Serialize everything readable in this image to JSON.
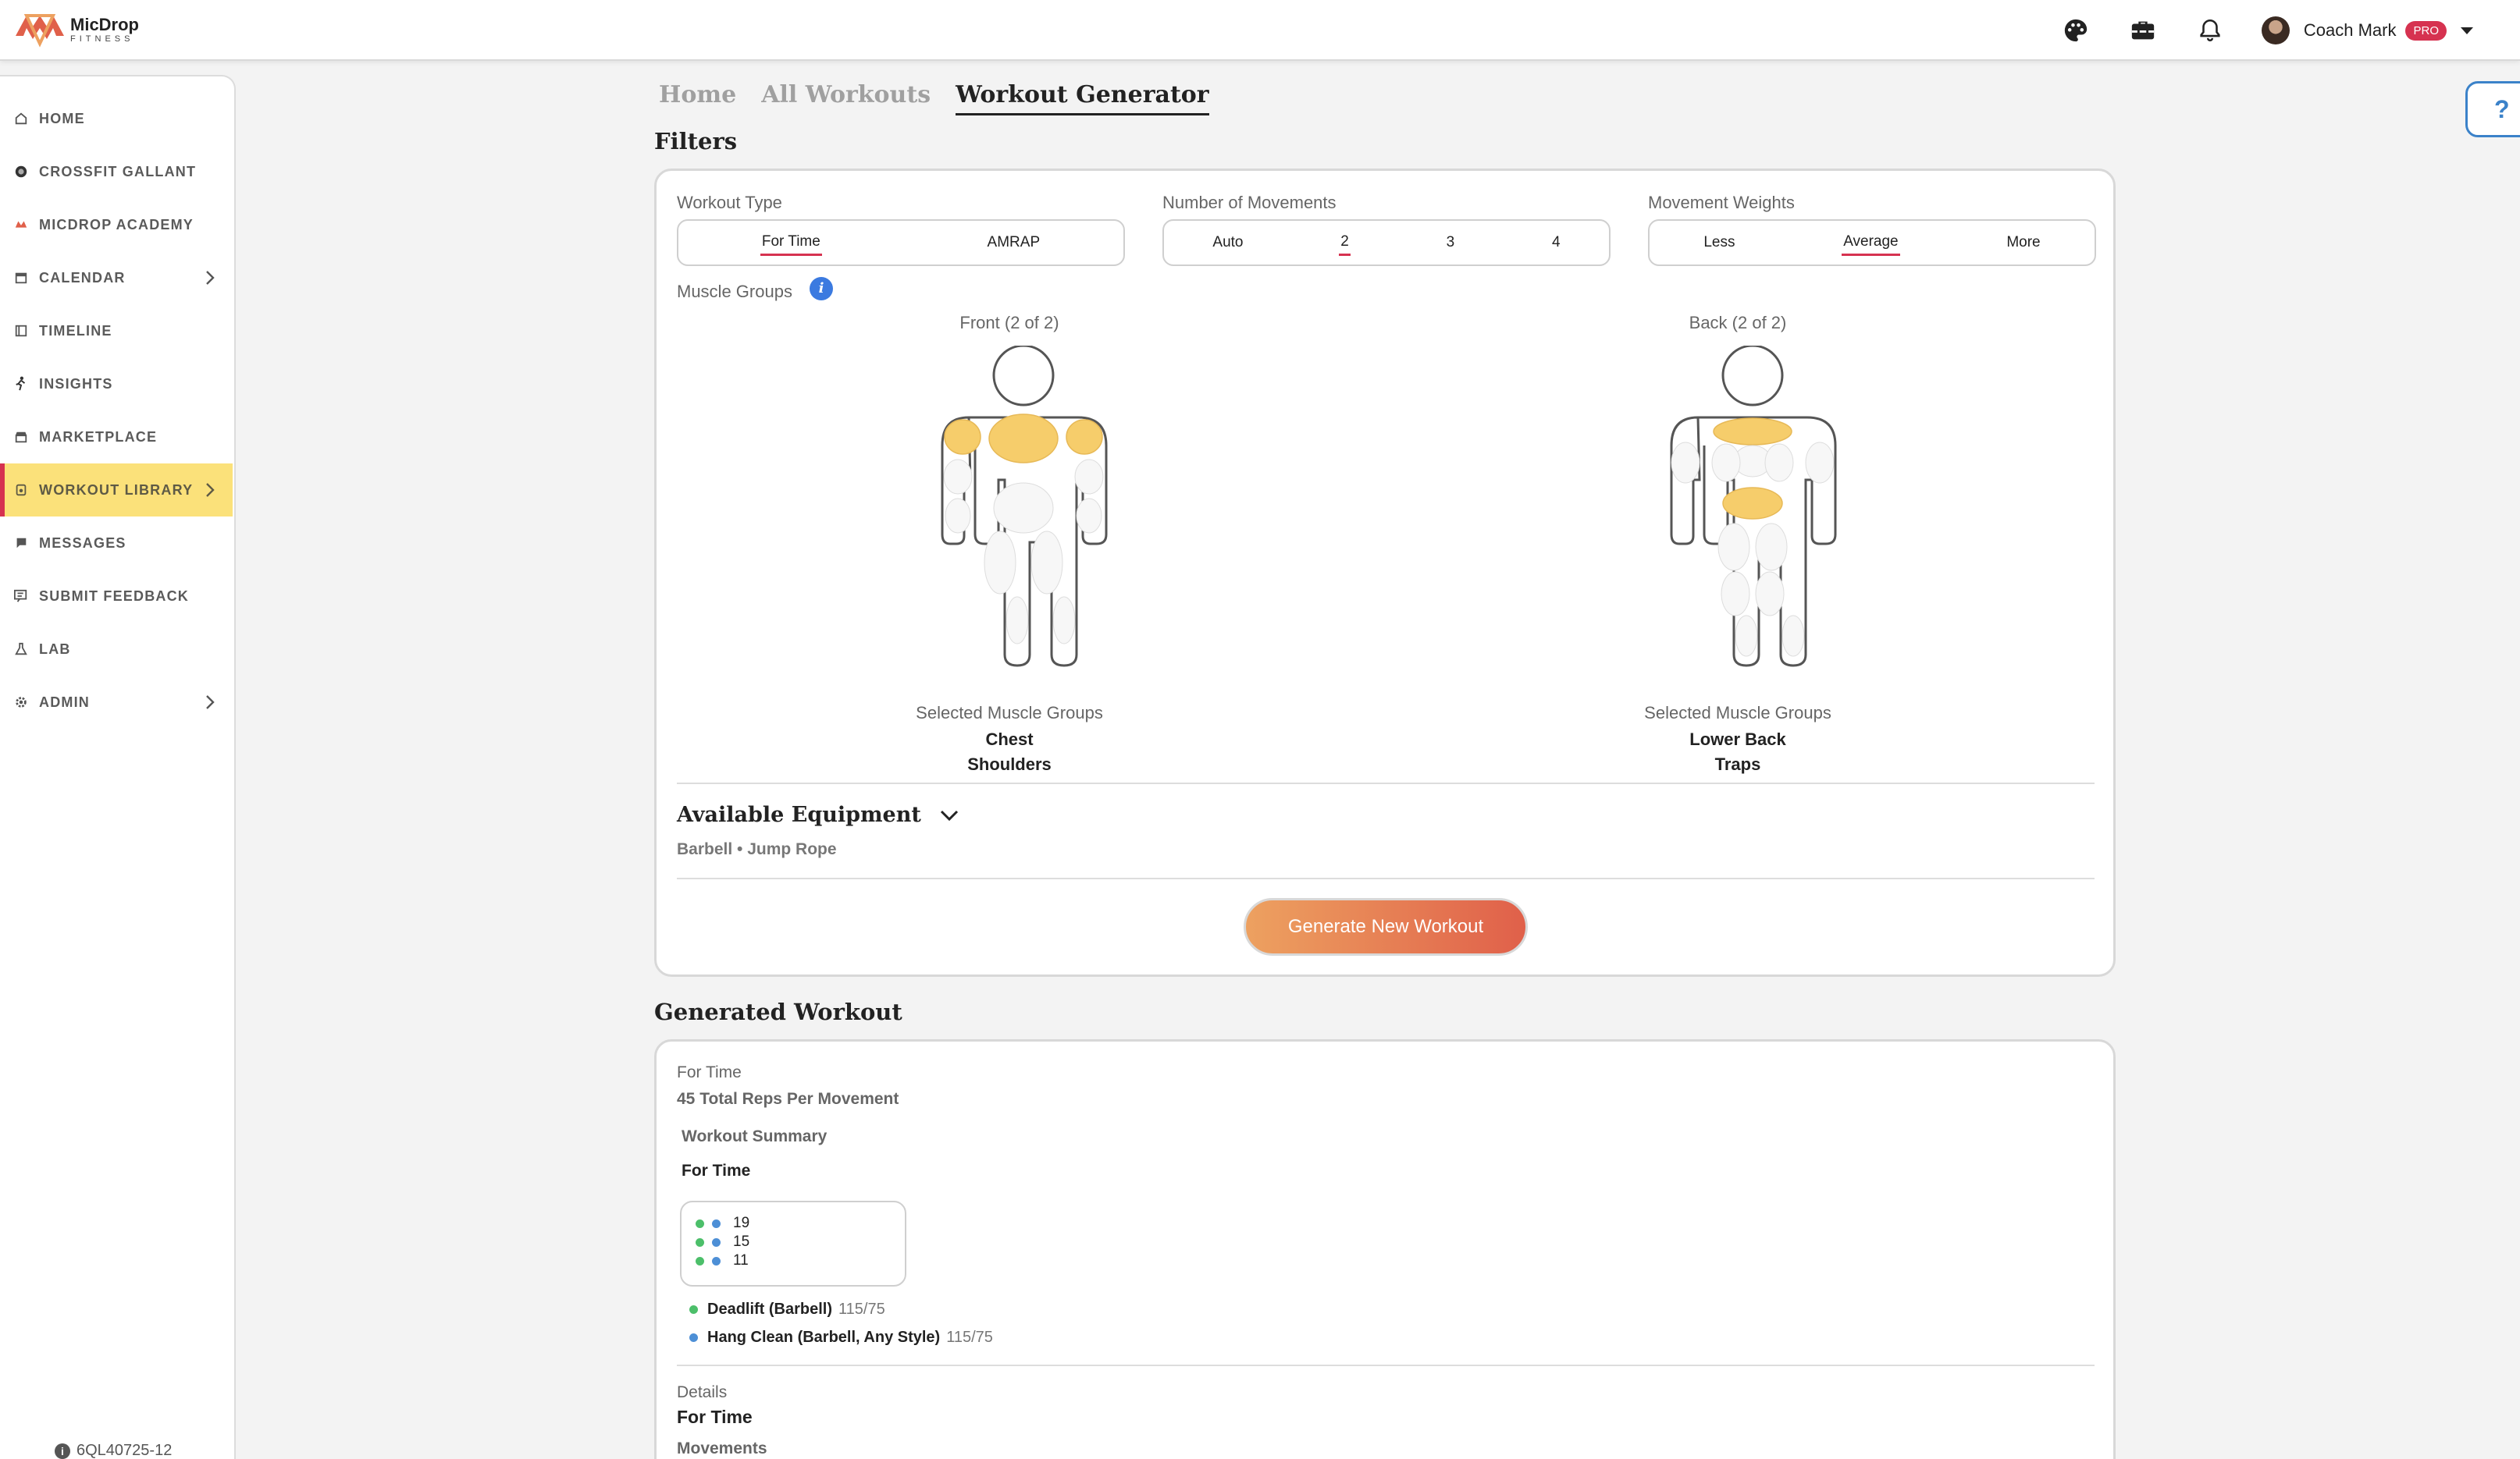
{
  "brand": {
    "name": "MicDrop",
    "sub": "FITNESS",
    "logo_icon": "micdrop-logo"
  },
  "header": {
    "icons": [
      "palette-icon",
      "toolbox-icon",
      "bell-icon"
    ],
    "user_name": "Coach Mark",
    "badge": "PRO"
  },
  "sidebar": {
    "items": [
      {
        "label": "HOME",
        "icon": "home-icon"
      },
      {
        "label": "CROSSFIT GALLANT",
        "icon": "gym-logo-icon"
      },
      {
        "label": "MICDROP ACADEMY",
        "icon": "academy-logo-icon"
      },
      {
        "label": "CALENDAR",
        "icon": "calendar-icon"
      },
      {
        "label": "TIMELINE",
        "icon": "timeline-icon"
      },
      {
        "label": "INSIGHTS",
        "icon": "insights-icon"
      },
      {
        "label": "MARKETPLACE",
        "icon": "store-icon"
      },
      {
        "label": "WORKOUT LIBRARY",
        "icon": "library-icon"
      },
      {
        "label": "MESSAGES",
        "icon": "chat-icon"
      },
      {
        "label": "SUBMIT FEEDBACK",
        "icon": "feedback-icon"
      },
      {
        "label": "LAB",
        "icon": "flask-icon"
      },
      {
        "label": "ADMIN",
        "icon": "gear-icon"
      }
    ],
    "active_label": "WORKOUT LIBRARY",
    "version": "6QL40725-12"
  },
  "help": {
    "label": "?"
  },
  "tabs": [
    "Home",
    "All Workouts",
    "Workout Generator"
  ],
  "active_tab": "Workout Generator",
  "filters": {
    "title": "Filters",
    "workout_type": {
      "label": "Workout Type",
      "options": [
        "For Time",
        "AMRAP"
      ],
      "selected": "For Time"
    },
    "num_movements": {
      "label": "Number of Movements",
      "options": [
        "Auto",
        "2",
        "3",
        "4"
      ],
      "selected": "2"
    },
    "movement_weights": {
      "label": "Movement Weights",
      "options": [
        "Less",
        "Average",
        "More"
      ],
      "selected": "Average"
    },
    "muscle_groups_label": "Muscle Groups",
    "info_icon": "i",
    "front": {
      "caption": "Front (2 of 2)",
      "selected_title": "Selected Muscle Groups",
      "selected": [
        "Chest",
        "Shoulders"
      ]
    },
    "back": {
      "caption": "Back (2 of 2)",
      "selected_title": "Selected Muscle Groups",
      "selected": [
        "Lower Back",
        "Traps"
      ]
    },
    "highlight_color": "#f6cd6b",
    "equipment_title": "Available Equipment",
    "equipment_list": "Barbell • Jump Rope",
    "generate_button": "Generate New Workout"
  },
  "generated": {
    "title": "Generated Workout",
    "type": "For Time",
    "total_reps": "45 Total Reps Per Movement",
    "summary_title": "Workout Summary",
    "summary_type": "For Time",
    "reps": [
      "19",
      "15",
      "11"
    ],
    "movements": [
      {
        "name": "Deadlift (Barbell)",
        "weight": "115/75",
        "color": "#4cbf6a"
      },
      {
        "name": "Hang Clean (Barbell, Any Style)",
        "weight": "115/75",
        "color": "#4d8fd6"
      }
    ],
    "details_label": "Details",
    "details_type": "For Time",
    "movements_label": "Movements"
  },
  "colors": {
    "accent_red": "#d63250",
    "active_nav": "#fbe17a",
    "button_start": "#eda160",
    "button_end": "#e0604a",
    "dot_green": "#4cbf6a",
    "dot_blue": "#4d8fd6"
  }
}
